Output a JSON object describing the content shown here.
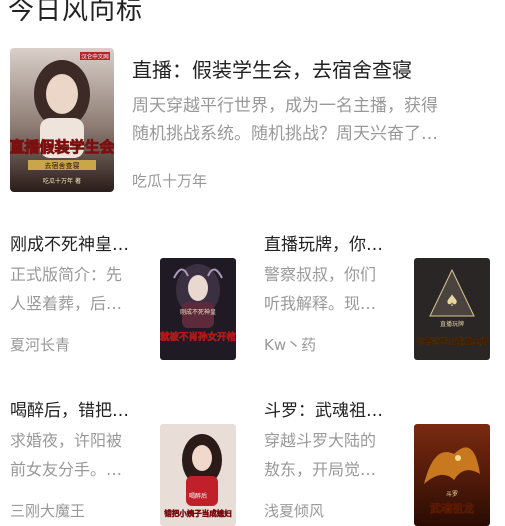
{
  "section": {
    "title": "今日风向标"
  },
  "featured": {
    "title": "直播：假装学生会，去宿舍查寝",
    "desc_line1": "周天穿越平行世界，成为一名主播，获得",
    "desc_line2": "随机挑战系统。随机挑战？周天兴奋了…",
    "author": "吃瓜十万年",
    "cover_text_main": "直播假装学生会",
    "cover_text_sub": "去宿舍查寝",
    "cover_author": "吃瓜十万年 著",
    "cover_publisher": "汉仑中文网"
  },
  "books": [
    {
      "title": "刚成不死神皇…",
      "desc_line1": "正式版简介：先",
      "desc_line2": "人竖着葬，后…",
      "author": "夏河长青",
      "cover_text": "就被不肖孙女开棺",
      "cover_subtext": "刚成不死神皇"
    },
    {
      "title": "直播玩牌，你…",
      "desc_line1": "警察叔叔，你们",
      "desc_line2": "听我解释。现…",
      "author": "Kw丶药",
      "cover_text": "你管这叫正能量主播",
      "cover_subtext": "直播玩牌"
    },
    {
      "title": "喝醉后，错把…",
      "desc_line1": "求婚夜，许阳被",
      "desc_line2": "前女友分手。…",
      "author": "三刚大魔王",
      "cover_text": "错把小姨子当成媳妇",
      "cover_subtext": "喝醉后"
    },
    {
      "title": "斗罗：武魂祖…",
      "desc_line1": "穿越斗罗大陆的",
      "desc_line2": "敖东，开局觉…",
      "author": "浅夏倾风",
      "cover_text": "武魂祖龙",
      "cover_subtext": "斗罗"
    }
  ],
  "colors": {
    "title": "#222222",
    "secondary_text": "#999999",
    "background": "#ffffff"
  }
}
